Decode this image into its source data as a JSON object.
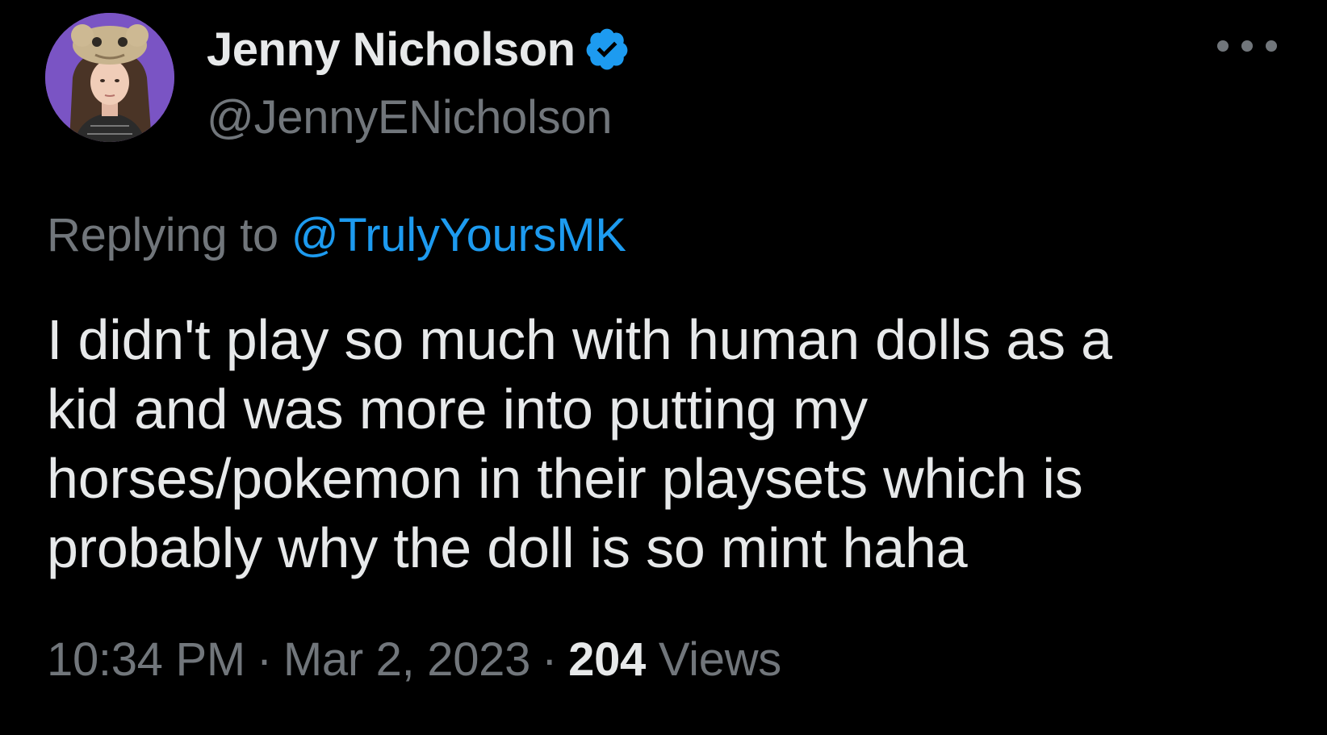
{
  "author": {
    "display_name": "Jenny Nicholson",
    "handle": "@JennyENicholson",
    "verified": true,
    "avatar_icon": "profile-photo"
  },
  "reply": {
    "prefix": "Replying to",
    "mention": "@TrulyYoursMK"
  },
  "tweet": {
    "lines": [
      "I didn't play so much with human dolls as a",
      "kid and was more into putting my",
      "horses/pokemon in their playsets which is",
      "probably why the doll is so mint haha"
    ]
  },
  "meta": {
    "time": "10:34 PM",
    "separator": "·",
    "date": "Mar 2, 2023",
    "views_count": "204",
    "views_label": "Views"
  },
  "colors": {
    "background": "#000000",
    "text_primary": "#e7e9ea",
    "text_secondary": "#71767b",
    "accent": "#1d9bf0"
  },
  "icons": {
    "verified": "verified-badge-icon",
    "more": "more-options-icon"
  }
}
